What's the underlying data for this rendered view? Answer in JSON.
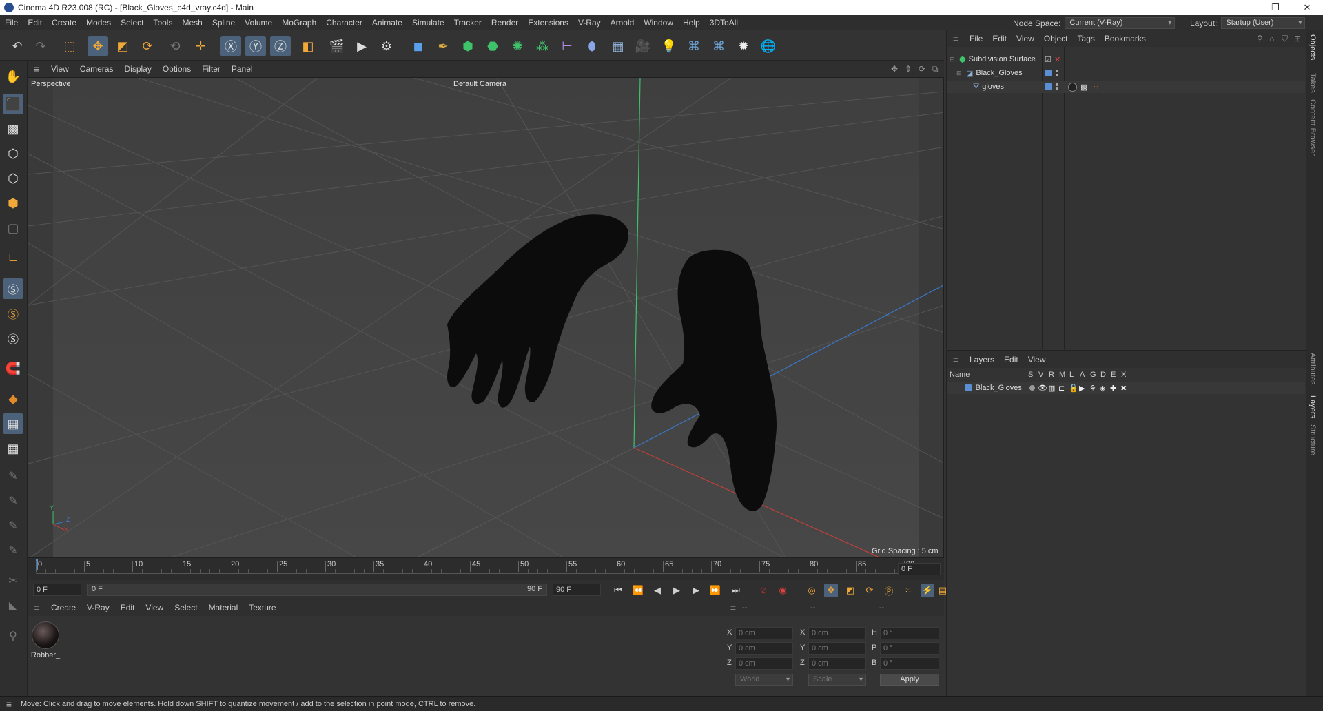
{
  "window": {
    "title": "Cinema 4D R23.008 (RC) - [Black_Gloves_c4d_vray.c4d] - Main",
    "minimize": "—",
    "maximize": "❐",
    "close": "✕"
  },
  "menubar": {
    "items": [
      "File",
      "Edit",
      "Create",
      "Modes",
      "Select",
      "Tools",
      "Mesh",
      "Spline",
      "Volume",
      "MoGraph",
      "Character",
      "Animate",
      "Simulate",
      "Tracker",
      "Render",
      "Extensions",
      "V-Ray",
      "Arnold",
      "Window",
      "Help",
      "3DToAll"
    ],
    "node_space_label": "Node Space:",
    "node_space_value": "Current (V-Ray)",
    "layout_label": "Layout:",
    "layout_value": "Startup (User)"
  },
  "viewport": {
    "menu": [
      "View",
      "Cameras",
      "Display",
      "Options",
      "Filter",
      "Panel"
    ],
    "projection": "Perspective",
    "camera": "Default Camera",
    "grid_spacing": "Grid Spacing : 5 cm",
    "axis_y": "Y",
    "axis_z": "Z",
    "axis_x": "X"
  },
  "timeline": {
    "ticks": [
      "0",
      "5",
      "10",
      "15",
      "20",
      "25",
      "30",
      "35",
      "40",
      "45",
      "50",
      "55",
      "60",
      "65",
      "70",
      "75",
      "80",
      "85",
      "90"
    ],
    "current_frame": "0 F",
    "start_field": "0 F",
    "range_start": "0 F",
    "range_end": "90 F",
    "end_field": "90 F"
  },
  "material_panel": {
    "menu": [
      "Create",
      "V-Ray",
      "Edit",
      "View",
      "Select",
      "Material",
      "Texture"
    ],
    "materials": [
      {
        "name": "Robber_"
      }
    ]
  },
  "coordinates": {
    "col_headers": [
      "--",
      "--",
      "--"
    ],
    "rows": [
      {
        "a": "X",
        "a_val": "0 cm",
        "b": "X",
        "b_val": "0 cm",
        "c": "H",
        "c_val": "0 °"
      },
      {
        "a": "Y",
        "a_val": "0 cm",
        "b": "Y",
        "b_val": "0 cm",
        "c": "P",
        "c_val": "0 °"
      },
      {
        "a": "Z",
        "a_val": "0 cm",
        "b": "Z",
        "b_val": "0 cm",
        "c": "B",
        "c_val": "0 °"
      }
    ],
    "space": "World",
    "mode": "Scale",
    "apply": "Apply"
  },
  "object_manager": {
    "menu": [
      "File",
      "Edit",
      "View",
      "Object",
      "Tags",
      "Bookmarks"
    ],
    "objects": [
      {
        "name": "Subdivision Surface",
        "indent": 0
      },
      {
        "name": "Black_Gloves",
        "indent": 1
      },
      {
        "name": "gloves",
        "indent": 2
      }
    ]
  },
  "layer_manager": {
    "menu": [
      "Layers",
      "Edit",
      "View"
    ],
    "columns": [
      "Name",
      "S",
      "V",
      "R",
      "M",
      "L",
      "A",
      "G",
      "D",
      "E",
      "X"
    ],
    "layers": [
      {
        "name": "Black_Gloves",
        "color": "#5a8fd6"
      }
    ]
  },
  "side_tabs": [
    "Objects",
    "Takes",
    "Content Browser",
    "Attributes",
    "Layers",
    "Structure"
  ],
  "status": "Move: Click and drag to move elements. Hold down SHIFT to quantize movement / add to the selection in point mode, CTRL to remove.",
  "colors": {
    "accent": "#4c627a",
    "layer": "#5a8fd6",
    "axis_x": "#c0403a",
    "axis_y": "#3ec26a",
    "axis_z": "#3a78c9"
  }
}
